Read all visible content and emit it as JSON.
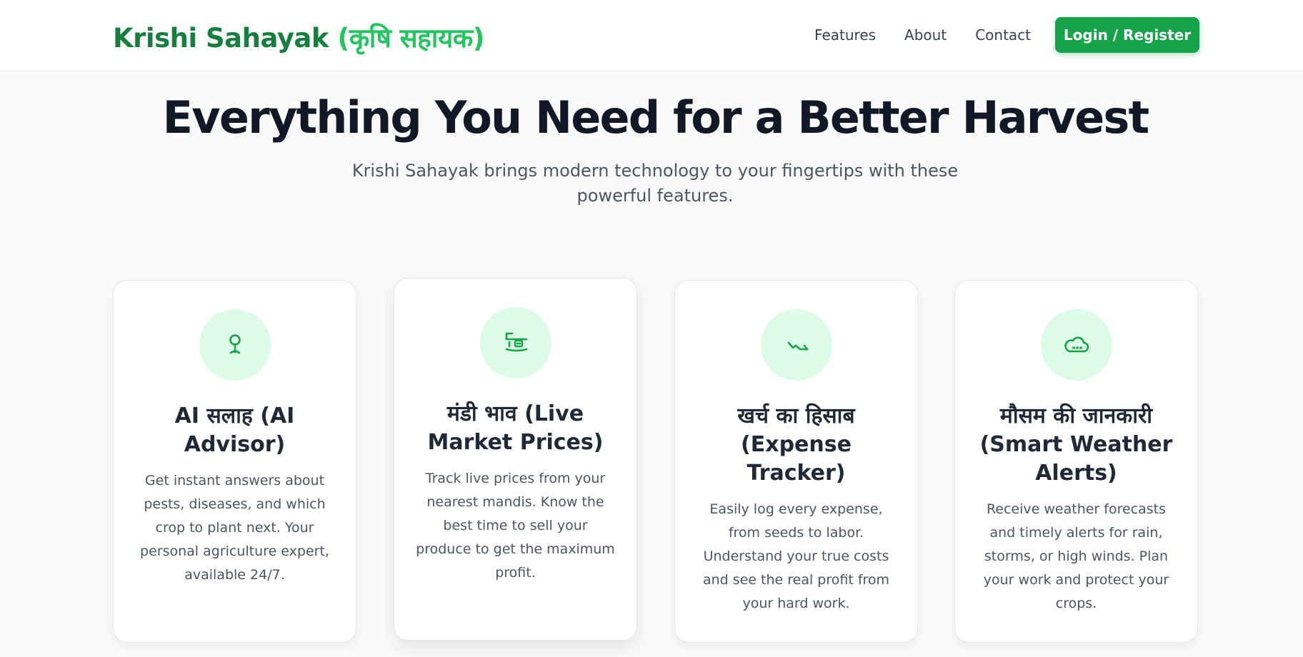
{
  "navbar": {
    "brand_en": "Krishi Sahayak",
    "brand_hi": "(कृषि सहायक)",
    "links": [
      "Features",
      "About",
      "Contact"
    ],
    "login_label": "Login / Register"
  },
  "hero": {
    "title": "Everything You Need for a Better Harvest",
    "subtitle": "Krishi Sahayak brings modern technology to your fingertips with these powerful features."
  },
  "features": [
    {
      "icon": "lightbulb-icon",
      "title": "AI सलाह (AI Advisor)",
      "description": "Get instant answers about pests, diseases, and which crop to plant next. Your personal agriculture expert, available 24/7."
    },
    {
      "icon": "market-stall-icon",
      "title": "मंडी भाव (Live Market Prices)",
      "description": "Track live prices from your nearest mandis. Know the best time to sell your produce to get the maximum profit."
    },
    {
      "icon": "trend-arrow-icon",
      "title": "खर्च का हिसाब (Expense Tracker)",
      "description": "Easily log every expense, from seeds to labor. Understand your true costs and see the real profit from your hard work."
    },
    {
      "icon": "cloud-icon",
      "title": "मौसम की जानकारी (Smart Weather Alerts)",
      "description": "Receive weather forecasts and timely alerts for rain, storms, or high winds. Plan your work and protect your crops."
    }
  ],
  "colors": {
    "brand_green": "#15803d",
    "brand_light_green": "#22c55e",
    "button_green": "#16a34a",
    "icon_bg": "#dcfce7"
  }
}
